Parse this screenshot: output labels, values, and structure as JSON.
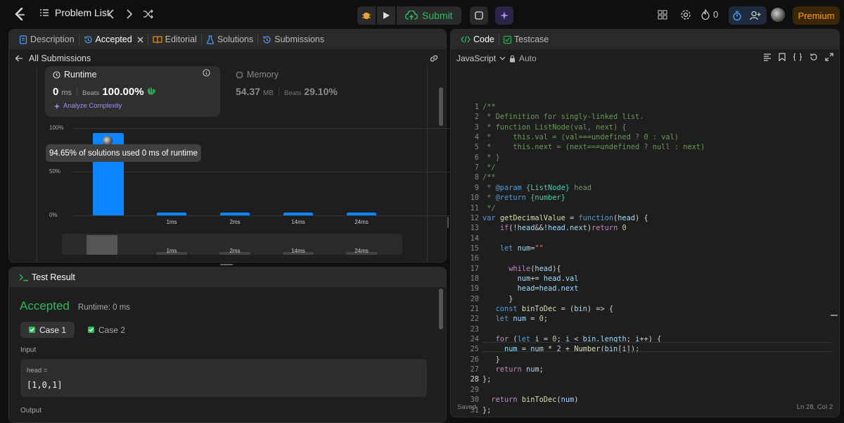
{
  "topbar": {
    "problem_list": "Problem List",
    "submit_label": "Submit",
    "streak_count": "0",
    "premium_label": "Premium"
  },
  "left": {
    "tabs": [
      {
        "label": "Description"
      },
      {
        "label": "Accepted"
      },
      {
        "label": "Editorial"
      },
      {
        "label": "Solutions"
      },
      {
        "label": "Submissions"
      }
    ],
    "back_label": "All Submissions",
    "runtime": {
      "title": "Runtime",
      "value": "0",
      "unit": "ms",
      "beats_label": "Beats",
      "beats_value": "100.00%",
      "analyze": "Analyze Complexity"
    },
    "memory": {
      "title": "Memory",
      "value": "54.37",
      "unit": "MB",
      "beats_label": "Beats",
      "beats_value": "29.10%"
    },
    "tooltip": "94.65% of solutions used 0 ms of runtime"
  },
  "chart_data": {
    "type": "bar",
    "categories": [
      "",
      "1ms",
      "2ms",
      "14ms",
      "24ms"
    ],
    "values": [
      94.65,
      1,
      1,
      1,
      1
    ],
    "yticks": [
      "100%",
      "50%",
      "0%"
    ],
    "ylim": [
      0,
      100
    ]
  },
  "overview_labels": [
    "1ms",
    "2ms",
    "14ms",
    "24ms"
  ],
  "test": {
    "title": "Test Result",
    "status": "Accepted",
    "runtime": "Runtime: 0 ms",
    "cases": [
      "Case 1",
      "Case 2"
    ],
    "input_label": "Input",
    "var_label": "head =",
    "var_value": "[1,0,1]",
    "output_label": "Output"
  },
  "editor": {
    "tabs": [
      {
        "label": "Code"
      },
      {
        "label": "Testcase"
      }
    ],
    "language": "JavaScript",
    "mode": "Auto",
    "status_left": "Saved",
    "status_right": "Ln 28, Col 2",
    "lines": [
      "/**",
      " * Definition for singly-linked list.",
      " * function ListNode(val, next) {",
      " *     this.val = (val===undefined ? 0 : val)",
      " *     this.next = (next===undefined ? null : next)",
      " * }",
      " */",
      "/**",
      " * @param {ListNode} head",
      " * @return {number}",
      " */",
      "var getDecimalValue = function(head) {",
      "    if(!head&&!head.next)return 0",
      "",
      "    let num=\"\"",
      "",
      "      while(head){",
      "        num+= head.val",
      "        head=head.next",
      "      }",
      "   const binToDec = (bin) => {",
      "   let num = 0;",
      "",
      "   for (let i = 0; i < bin.length; i++) {",
      "     num = num * 2 + Number(bin[i]);",
      "   }",
      "   return num;",
      "};",
      "",
      "  return binToDec(num)",
      "};"
    ]
  }
}
